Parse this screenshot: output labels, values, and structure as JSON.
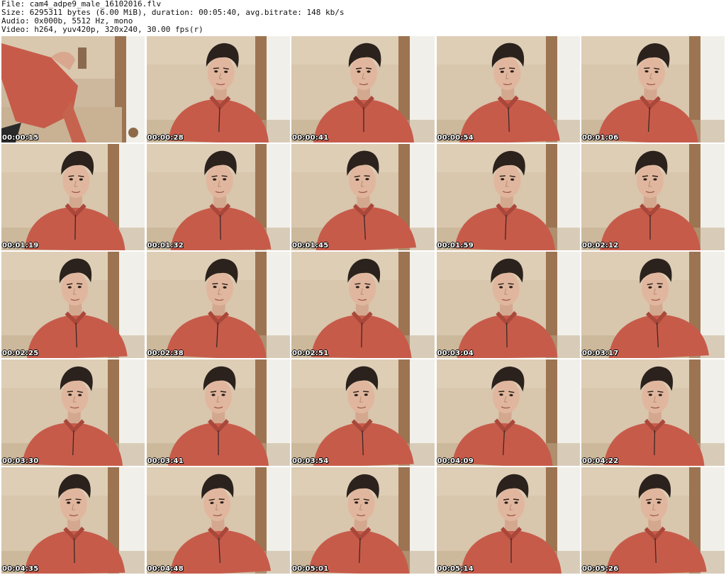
{
  "header": {
    "file_line": "File: cam4_adpe9_male_16102016.flv",
    "size_line": "Size: 6295311 bytes (6.00 MiB), duration: 00:05:40, avg.bitrate: 148 kb/s",
    "audio_line": "Audio: 0x000b, 5512 Hz, mono",
    "video_line": "Video: h264, yuv420p, 320x240, 30.00 fps(r)"
  },
  "colors": {
    "wall": "#d8c6ad",
    "sweater": "#c75b4a",
    "hair": "#2b221d",
    "skin": "#e0b79e",
    "door_white": "#f1efe9",
    "trim": "#9c7452"
  },
  "thumbnails": [
    {
      "time": "00:00:15",
      "scene": "intro"
    },
    {
      "time": "00:00:28",
      "scene": "portrait"
    },
    {
      "time": "00:00:41",
      "scene": "portrait"
    },
    {
      "time": "00:00:54",
      "scene": "portrait"
    },
    {
      "time": "00:01:06",
      "scene": "portrait"
    },
    {
      "time": "00:01:19",
      "scene": "portrait"
    },
    {
      "time": "00:01:32",
      "scene": "portrait"
    },
    {
      "time": "00:01:45",
      "scene": "portrait"
    },
    {
      "time": "00:01:59",
      "scene": "portrait"
    },
    {
      "time": "00:02:12",
      "scene": "portrait"
    },
    {
      "time": "00:02:25",
      "scene": "portrait"
    },
    {
      "time": "00:02:38",
      "scene": "portrait"
    },
    {
      "time": "00:02:51",
      "scene": "portrait"
    },
    {
      "time": "00:03:04",
      "scene": "portrait"
    },
    {
      "time": "00:03:17",
      "scene": "portrait"
    },
    {
      "time": "00:03:30",
      "scene": "portrait"
    },
    {
      "time": "00:03:41",
      "scene": "portrait"
    },
    {
      "time": "00:03:54",
      "scene": "portrait"
    },
    {
      "time": "00:04:09",
      "scene": "portrait"
    },
    {
      "time": "00:04:22",
      "scene": "portrait"
    },
    {
      "time": "00:04:35",
      "scene": "portrait"
    },
    {
      "time": "00:04:48",
      "scene": "portrait"
    },
    {
      "time": "00:05:01",
      "scene": "portrait"
    },
    {
      "time": "00:05:14",
      "scene": "portrait"
    },
    {
      "time": "00:05:26",
      "scene": "portrait"
    }
  ]
}
